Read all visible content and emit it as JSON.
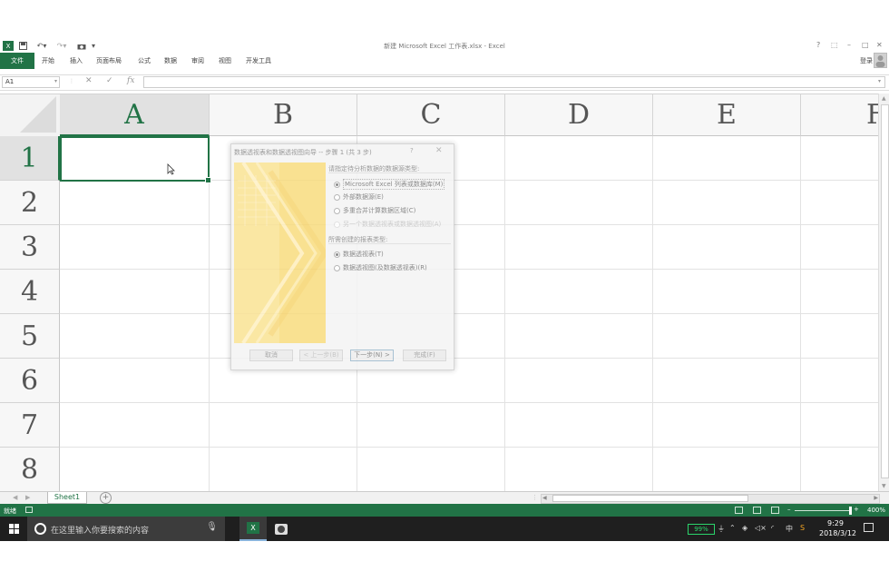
{
  "window": {
    "title": "新建 Microsoft Excel 工作表.xlsx - Excel",
    "help": "?",
    "minimize": "–",
    "restore": "□",
    "close": "✕",
    "ribbon_display": "⬚"
  },
  "ribbon": {
    "file_tab": "文件",
    "tabs": [
      "开始",
      "插入",
      "页面布局",
      "公式",
      "数据",
      "审阅",
      "视图",
      "开发工具"
    ],
    "signin": "登录"
  },
  "formula_bar": {
    "name_box": "A1",
    "cancel": "✕",
    "enter": "✓",
    "fx": "fx",
    "value": ""
  },
  "grid": {
    "columns": [
      "A",
      "B",
      "C",
      "D",
      "E",
      "F"
    ],
    "rows": [
      "1",
      "2",
      "3",
      "4",
      "5",
      "6",
      "7",
      "8"
    ],
    "active_cell": "A1"
  },
  "dialog": {
    "title": "数据透视表和数据透视图向导 -- 步骤 1 (共 3 步)",
    "help": "?",
    "close": "✕",
    "group1_label": "请指定待分析数据的数据源类型:",
    "source_options": [
      {
        "label": "Microsoft Excel 列表或数据库(M)",
        "selected": true,
        "disabled": false
      },
      {
        "label": "外部数据源(E)",
        "selected": false,
        "disabled": false
      },
      {
        "label": "多重合并计算数据区域(C)",
        "selected": false,
        "disabled": false
      },
      {
        "label": "另一个数据透视表或数据透视图(A)",
        "selected": false,
        "disabled": true
      }
    ],
    "group2_label": "所需创建的报表类型:",
    "report_options": [
      {
        "label": "数据透视表(T)",
        "selected": true
      },
      {
        "label": "数据透视图(及数据透视表)(R)",
        "selected": false
      }
    ],
    "buttons": {
      "cancel": "取消",
      "back": "< 上一步(B)",
      "next": "下一步(N) >",
      "finish": "完成(F)"
    }
  },
  "sheets": {
    "tabs": [
      "Sheet1"
    ],
    "add": "+"
  },
  "status_bar": {
    "status": "就绪",
    "zoom": "400%",
    "zoom_minus": "–",
    "zoom_plus": "+"
  },
  "taskbar": {
    "search_placeholder": "在这里输入你要搜索的内容",
    "battery": "99%",
    "ime": "中",
    "time": "9:29",
    "date": "2018/3/12"
  },
  "colors": {
    "excel_green": "#217346",
    "dialog_art": "#f8dc7e",
    "taskbar": "#1f1f1f",
    "battery_green": "#2bd56b"
  }
}
